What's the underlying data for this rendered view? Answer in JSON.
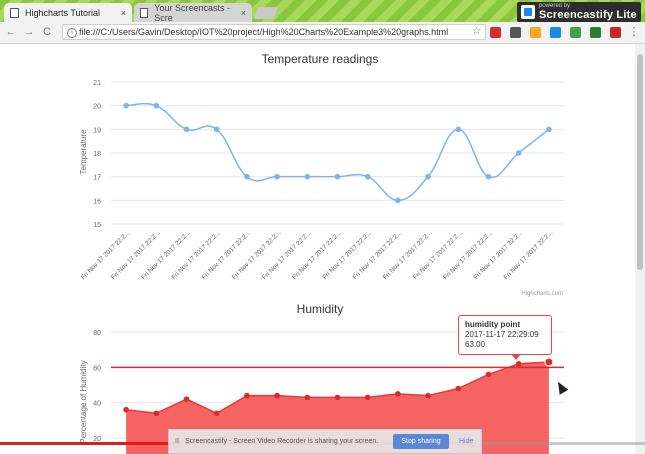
{
  "browser": {
    "tabs": [
      {
        "title": "Highcharts Tutorial",
        "close": "×",
        "active": true
      },
      {
        "title": "Your Screencasts - Scre",
        "close": "×",
        "active": false
      }
    ],
    "url": "file:///C:/Users/Gavin/Desktop/IOT%20project/High%20Charts%20Example3%20graphs.html",
    "nav": {
      "back": "←",
      "forward": "→",
      "reload": "C"
    },
    "star": "☆",
    "menu": "⋮",
    "extension_colors": [
      "#d32f2f",
      "#555555",
      "#f9a825",
      "#1e88e5",
      "#43a047",
      "#2e7d32",
      "#c62828",
      "#e53935"
    ]
  },
  "watermark": {
    "small": "powered by",
    "big": "Screencastify Lite"
  },
  "share_bar": {
    "pause": "II",
    "message": "Screencastify - Screen Video Recorder is sharing your screen.",
    "stop_label": "Stop sharing",
    "hide_label": "Hide"
  },
  "video_progress": 0.73,
  "credits": "Highcharts.com",
  "tooltip": {
    "series": "humidity point",
    "time": "2017-11-17 22:29:09",
    "value": "63.00"
  },
  "chart_data": [
    {
      "type": "line",
      "title": "Temperature readings",
      "ylabel": "Temperature",
      "xlabel": "",
      "ylim": [
        15,
        21
      ],
      "yticks": [
        15,
        16,
        17,
        18,
        19,
        20,
        21
      ],
      "categories": [
        "Fri Nov 17 2017 22:2...",
        "Fri Nov 17 2017 22:2...",
        "Fri Nov 17 2017 22:2...",
        "Fri Nov 17 2017 22:2...",
        "Fri Nov 17 2017 22:2...",
        "Fri Nov 17 2017 22:2...",
        "Fri Nov 17 2017 22:2...",
        "Fri Nov 17 2017 22:2...",
        "Fri Nov 17 2017 22:2...",
        "Fri Nov 17 2017 22:2...",
        "Fri Nov 17 2017 22:2...",
        "Fri Nov 17 2017 22:2...",
        "Fri Nov 17 2017 22:2...",
        "Fri Nov 17 2017 22:2...",
        "Fri Nov 17 2017 22:2..."
      ],
      "values": [
        20,
        20,
        19,
        19,
        17,
        17,
        17,
        17,
        17,
        16,
        17,
        19,
        17,
        18,
        19
      ],
      "color": "#7cb5ec",
      "grid": true,
      "legend": "none"
    },
    {
      "type": "area",
      "title": "Humidity",
      "ylabel": "Percentage of Humidity",
      "xlabel": "",
      "ylim": [
        20,
        80
      ],
      "yticks": [
        20,
        40,
        60,
        80
      ],
      "values": [
        36,
        34,
        42,
        34,
        44,
        44,
        43,
        43,
        43,
        45,
        44,
        48,
        56,
        62,
        63
      ],
      "plot_line": 60,
      "color": "#f45b5b",
      "grid": true,
      "legend": "none"
    }
  ]
}
